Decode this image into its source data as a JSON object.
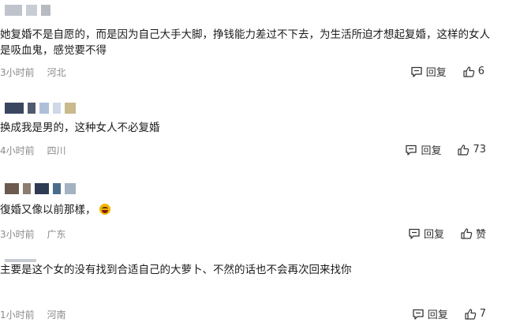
{
  "actions": {
    "reply_label": "回复"
  },
  "comments": [
    {
      "text": "她复婚不是自愿的，而是因为自己大手大脚，挣钱能力差过不下去，为生活所迫才想起复婚，这样的女人是吸血鬼，感觉要不得",
      "time": "3小时前",
      "location": "河北",
      "likes": "6",
      "avatar_colors": [
        "#bfc4cc",
        "#c8ccd4",
        "#b6bac1"
      ]
    },
    {
      "text": "换成我是男的，这种女人不必复婚",
      "time": "4小时前",
      "location": "四川",
      "likes": "73",
      "avatar_colors": [
        "#3a4660",
        "#505a70",
        "#aebfd9",
        "#cfd8e8",
        "#c9b98c"
      ]
    },
    {
      "text": "復婚又像以前那樣，",
      "time": "3小时前",
      "location": "广东",
      "likes": "赞",
      "avatar_colors": [
        "#6b5a4d",
        "#8c7d6f",
        "#2f3b52",
        "#4a6b8c",
        "#a3b3c2"
      ]
    },
    {
      "text": "主要是这个女的没有找到合适自己的大萝卜、不然的话也不会再次回来找你",
      "time": "1小时前",
      "location": "河南",
      "likes": "7",
      "avatar_colors": [
        "#c9ccd2"
      ]
    }
  ]
}
